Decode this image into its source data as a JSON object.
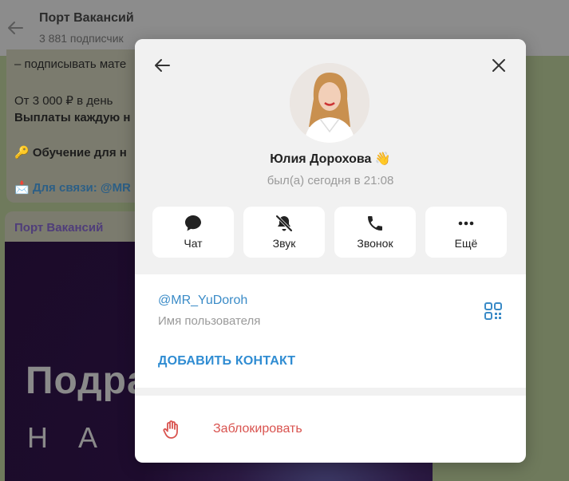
{
  "channel": {
    "title": "Порт Вакансий",
    "subscribers": "3 881 подписчик"
  },
  "messages": {
    "m1": [
      "– подписывать мате",
      "От 3 000 ₽ в день",
      "Выплаты каждую н",
      "🔑 Обучение для н",
      "📩 Для связи: @MR"
    ],
    "m2_sender": "Порт Вакансий",
    "m2_big": "Подра",
    "m2_na": "Н А"
  },
  "profile": {
    "name": "Юлия Дорохова",
    "name_emoji": "👋",
    "status": "был(а) сегодня в 21:08",
    "actions": [
      {
        "label": "Чат",
        "icon": "chat-icon"
      },
      {
        "label": "Звук",
        "icon": "bell-muted-icon"
      },
      {
        "label": "Звонок",
        "icon": "phone-icon"
      },
      {
        "label": "Ещё",
        "icon": "more-icon"
      }
    ],
    "username": "@MR_YuDoroh",
    "username_label": "Имя пользователя",
    "add_contact": "ДОБАВИТЬ КОНТАКТ",
    "block": "Заблокировать"
  },
  "colors": {
    "link": "#3a8bc7",
    "accent": "#2f8cd2",
    "danger": "#d9534f"
  }
}
